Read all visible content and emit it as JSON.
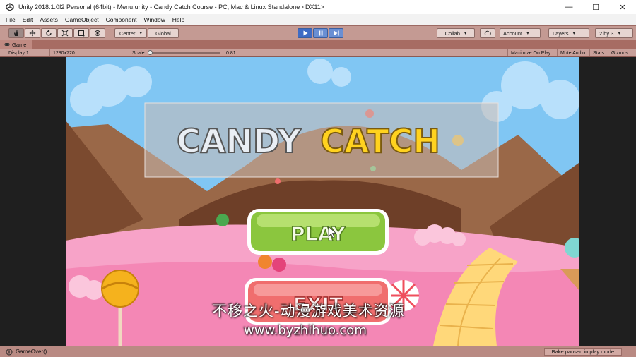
{
  "window": {
    "title": "Unity 2018.1.0f2 Personal (64bit) - Menu.unity - Candy Catch Course - PC, Mac & Linux Standalone <DX11>",
    "controls": [
      "—",
      "☐",
      "✕"
    ]
  },
  "menu": [
    "File",
    "Edit",
    "Assets",
    "GameObject",
    "Component",
    "Window",
    "Help"
  ],
  "toolbar": {
    "pivot_label": "Center",
    "space_label": "Global",
    "collab_label": "Collab",
    "account_label": "Account",
    "layers_label": "Layers",
    "layout_label": "2 by 3"
  },
  "game_tab": {
    "label": "Game",
    "display": "Display 1",
    "resolution": "1280x720",
    "scale_label": "Scale",
    "scale_value": "0.81",
    "maximize_on_play": "Maximize On Play",
    "mute_audio": "Mute Audio",
    "stats": "Stats",
    "gizmos": "Gizmos"
  },
  "game": {
    "title_left": "CANDY",
    "title_right": "CATCH",
    "play_label": "PLAY",
    "exit_label": "EXIT"
  },
  "status": {
    "message": "GameOver()",
    "right": "Bake paused in play mode"
  },
  "watermark": {
    "line1": "不移之火-动漫游戏美术资源",
    "line2": "www.byzhihuo.com"
  },
  "colors": {
    "sky": "#7fc4f2",
    "chocolate": "#8b5a3c",
    "pink": "#f7a6c7",
    "play_green": "#8bc63e",
    "exit_red": "#f06e6e",
    "title_yellow": "#ffd21f"
  }
}
